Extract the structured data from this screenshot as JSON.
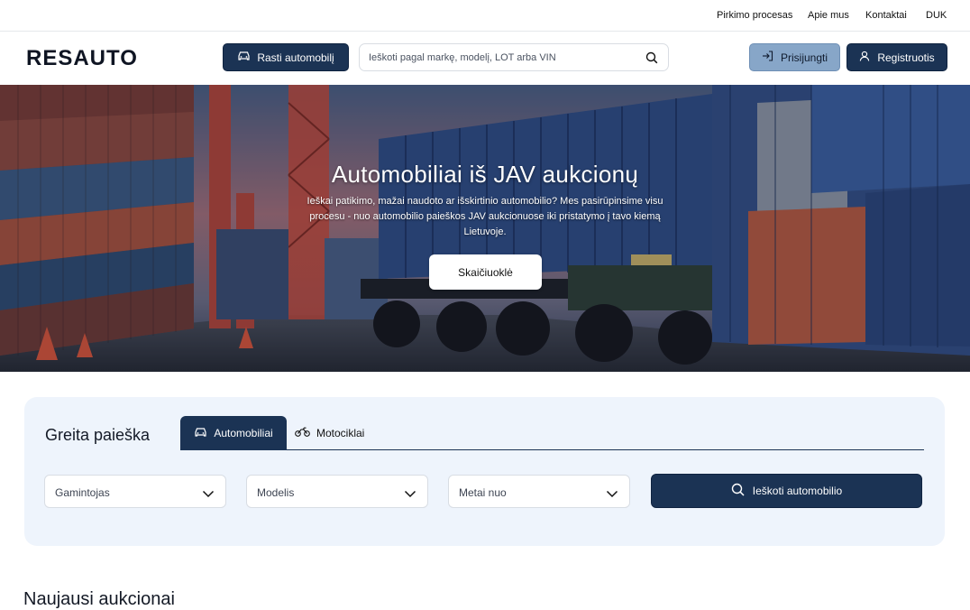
{
  "topbar": {
    "links": [
      "Pirkimo procesas",
      "Apie mus",
      "Kontaktai",
      "DUK"
    ]
  },
  "header": {
    "logo": "RESAUTO",
    "find_car_label": "Rasti automobilį",
    "search_placeholder": "Ieškoti pagal markę, modelį, LOT arba VIN",
    "login_label": "Prisijungti",
    "register_label": "Registruotis"
  },
  "hero": {
    "title": "Automobiliai iš JAV aukcionų",
    "text": "Ieškai patikimo, mažai naudoto ar išskirtinio automobilio? Mes pasirūpinsime visu procesu - nuo automobilio paieškos JAV aukcionuose iki pristatymo į tavo kiemą Lietuvoje.",
    "calc_label": "Skaičiuoklė"
  },
  "quick_search": {
    "title": "Greita paieška",
    "tabs": [
      {
        "label": "Automobiliai",
        "icon": "car-icon",
        "active": true
      },
      {
        "label": "Motociklai",
        "icon": "motorcycle-icon",
        "active": false
      }
    ],
    "selects": [
      "Gamintojas",
      "Modelis",
      "Metai nuo"
    ],
    "search_button": "Ieškoti automobilio"
  },
  "latest": {
    "title": "Naujausi aukcionai"
  },
  "colors": {
    "primary": "#1b3354",
    "login_bg": "#87a6c8",
    "panel_bg": "#eef4fc"
  }
}
